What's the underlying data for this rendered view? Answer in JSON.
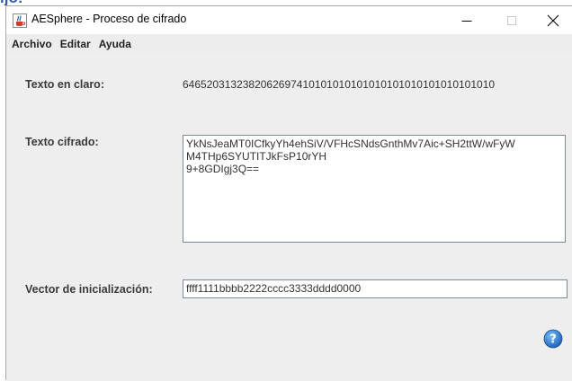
{
  "window": {
    "title": "AESphere - Proceso de cifrado",
    "controls": {
      "minimize": "—",
      "maximize": "☐",
      "close": "✕"
    }
  },
  "menubar": {
    "items": [
      "Archivo",
      "Editar",
      "Ayuda"
    ]
  },
  "form": {
    "plaintext": {
      "label": "Texto en claro:",
      "value": "6465203132382062697410101010101010101010101010101010"
    },
    "ciphertext": {
      "label": "Texto cifrado:",
      "lines": [
        "YkNsJeaMT0ICfkyYh4ehSiV/VFHcSNdsGnthMv7Aic+SH2ttW/wFyW",
        "M4THp6SYUTITJkFsP10rYH",
        "9+8GDIgj3Q=="
      ]
    },
    "iv": {
      "label": "Vector de inicialización:",
      "value": "ffff1111bbbb2222cccc3333dddd0000"
    }
  },
  "icons": {
    "app": "java-cup-icon",
    "help": "help-icon",
    "help_color": "#2f7fd0"
  }
}
